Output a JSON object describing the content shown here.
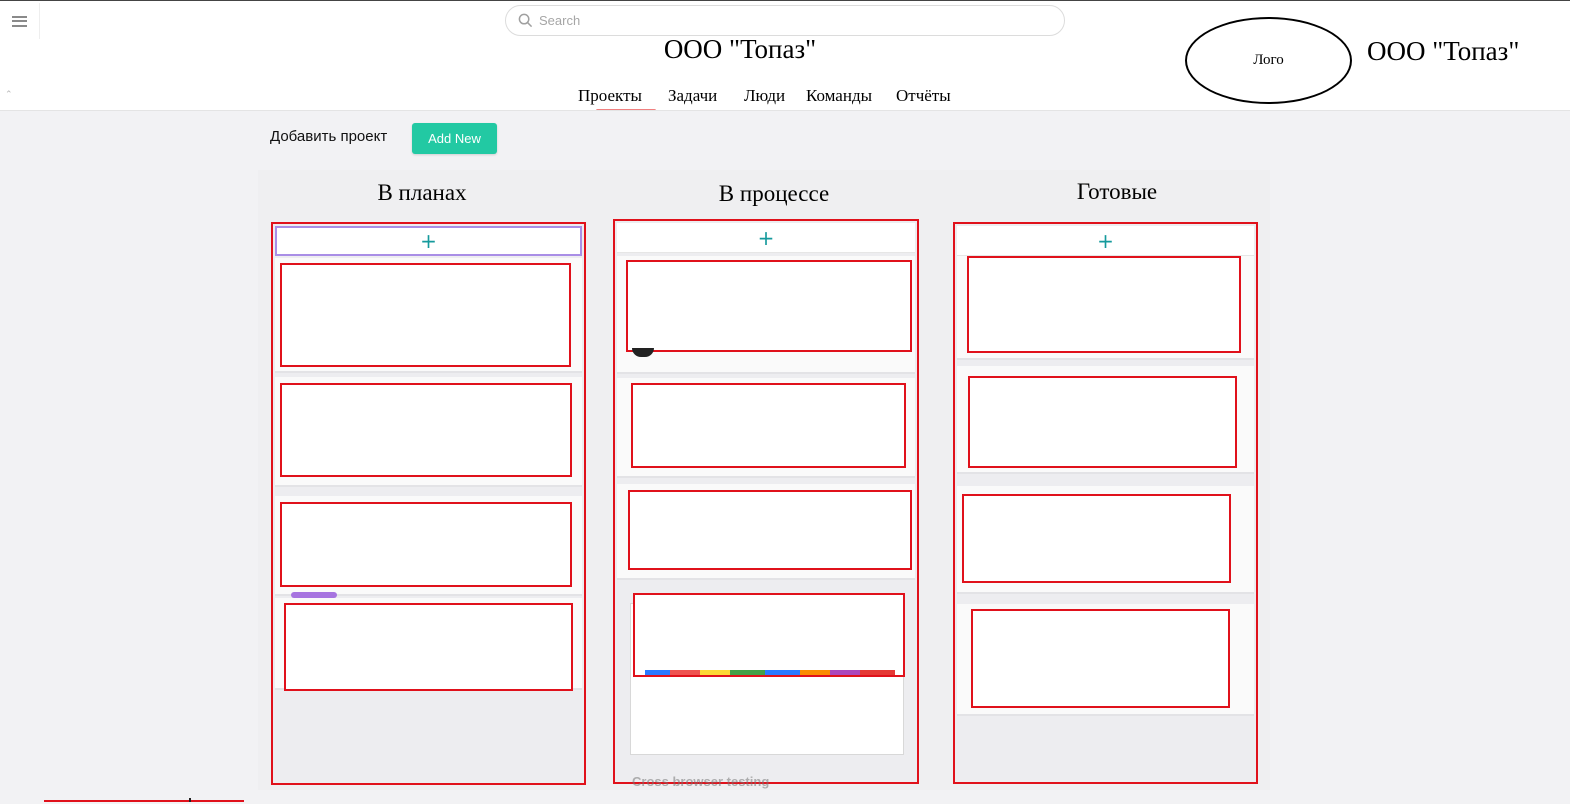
{
  "search": {
    "placeholder": "Search"
  },
  "header": {
    "company_name": "ООО \"Топаз\"",
    "company_name_right": "ООО \"Топаз\"",
    "logo_label": "Лого"
  },
  "nav": {
    "tabs": [
      {
        "label": "Проекты",
        "active": true
      },
      {
        "label": "Задачи",
        "active": false
      },
      {
        "label": "Люди",
        "active": false
      },
      {
        "label": "Команды",
        "active": false
      },
      {
        "label": "Отчёты",
        "active": false
      }
    ]
  },
  "toolbar": {
    "add_project_label": "Добавить проект",
    "add_new_label": "Add New"
  },
  "board": {
    "columns": [
      {
        "title": "В планах",
        "add_icon": "+"
      },
      {
        "title": "В процессе",
        "add_icon": "+"
      },
      {
        "title": "Готовые",
        "add_icon": "+"
      }
    ],
    "partial_card_text": "Cross browser testing"
  },
  "colors": {
    "accent": "#22c9a3",
    "highlight": "#e0111b",
    "plus": "#159a9c",
    "active_tab_underline": "#f08080",
    "tag_purple": "#a774e0",
    "tag_green": "#8bc34a"
  },
  "icons": [
    "menu-icon",
    "search-icon",
    "plus-icon"
  ]
}
